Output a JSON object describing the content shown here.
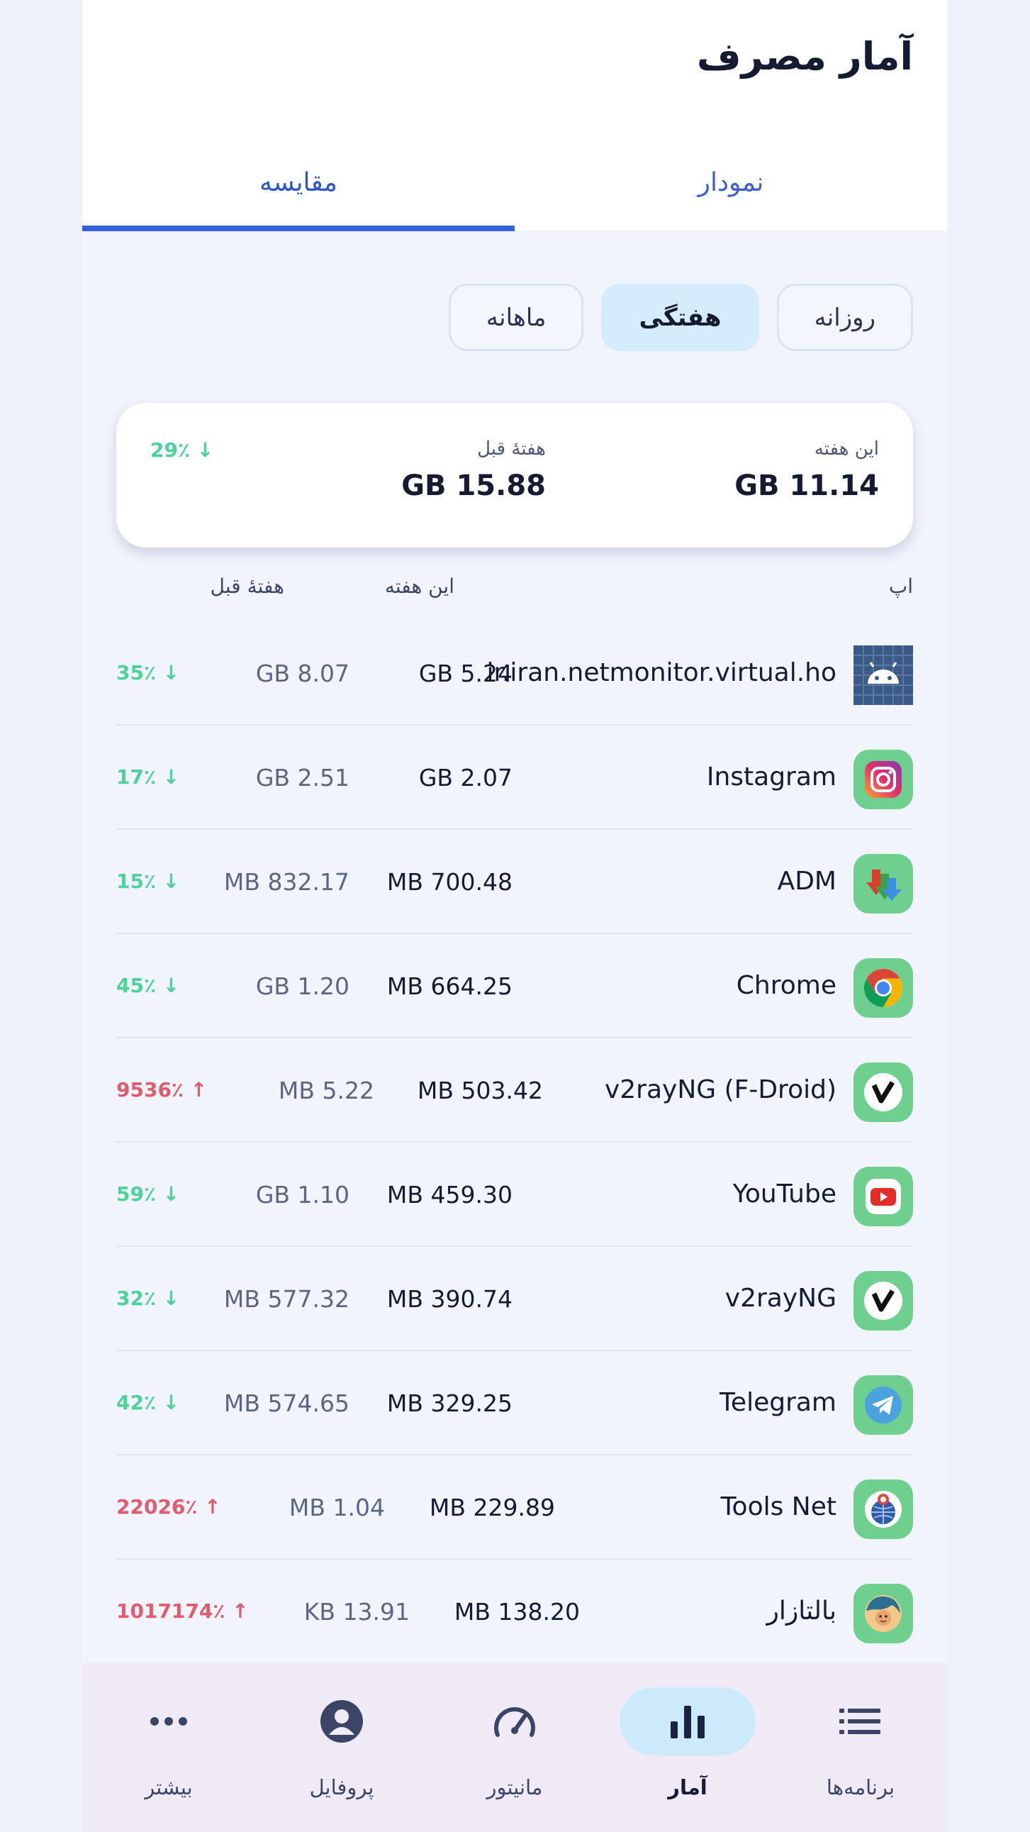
{
  "header": {
    "title": "آمار مصرف"
  },
  "tabs": [
    {
      "label": "نمودار"
    },
    {
      "label": "مقایسه"
    }
  ],
  "periods": [
    {
      "label": "روزانه"
    },
    {
      "label": "هفتگی"
    },
    {
      "label": "ماهانه"
    }
  ],
  "summary": {
    "this_label": "این هفته",
    "this_value": "GB 11.14",
    "prev_label": "هفتهٔ قبل",
    "prev_value": "GB 15.88",
    "change": "29٪ ↓"
  },
  "columns": {
    "app": "اپ",
    "this_week": "این هفته",
    "prev_week": "هفتهٔ قبل"
  },
  "apps": [
    {
      "name": "ir.iran.netmonitor.virtual.ho",
      "this": "GB 5.24",
      "prev": "GB 8.07",
      "change": "35٪ ↓",
      "direction": "down",
      "icon": "android-icon"
    },
    {
      "name": "Instagram",
      "this": "GB 2.07",
      "prev": "GB 2.51",
      "change": "17٪ ↓",
      "direction": "down",
      "icon": "instagram-icon"
    },
    {
      "name": "ADM",
      "this": "MB 700.48",
      "prev": "MB 832.17",
      "change": "15٪ ↓",
      "direction": "down",
      "icon": "adm-icon"
    },
    {
      "name": "Chrome",
      "this": "MB 664.25",
      "prev": "GB 1.20",
      "change": "45٪ ↓",
      "direction": "down",
      "icon": "chrome-icon"
    },
    {
      "name": "v2rayNG (F-Droid)",
      "this": "MB 503.42",
      "prev": "MB 5.22",
      "change": "9536٪ ↑",
      "direction": "up",
      "icon": "v2ray-icon"
    },
    {
      "name": "YouTube",
      "this": "MB 459.30",
      "prev": "GB 1.10",
      "change": "59٪ ↓",
      "direction": "down",
      "icon": "youtube-icon"
    },
    {
      "name": "v2rayNG",
      "this": "MB 390.74",
      "prev": "MB 577.32",
      "change": "32٪ ↓",
      "direction": "down",
      "icon": "v2ray-icon"
    },
    {
      "name": "Telegram",
      "this": "MB 329.25",
      "prev": "MB 574.65",
      "change": "42٪ ↓",
      "direction": "down",
      "icon": "telegram-icon"
    },
    {
      "name": "Tools Net",
      "this": "MB 229.89",
      "prev": "MB 1.04",
      "change": "22026٪ ↑",
      "direction": "up",
      "icon": "toolsnet-icon"
    },
    {
      "name": "بالتازار",
      "this": "MB 138.20",
      "prev": "KB 13.91",
      "change": "1017174٪ ↑",
      "direction": "up",
      "icon": "avatar-icon"
    }
  ],
  "nav": [
    {
      "label": "برنامه‌ها",
      "icon": "list-icon"
    },
    {
      "label": "آمار",
      "icon": "bar-chart-icon"
    },
    {
      "label": "مانیتور",
      "icon": "speedometer-icon"
    },
    {
      "label": "پروفایل",
      "icon": "profile-icon"
    },
    {
      "label": "بیشتر",
      "icon": "more-icon"
    }
  ],
  "colors": {
    "accent": "#3561d9",
    "down": "#4bd39a",
    "up": "#e25a6e",
    "selected_chip": "#d4ecfb"
  }
}
